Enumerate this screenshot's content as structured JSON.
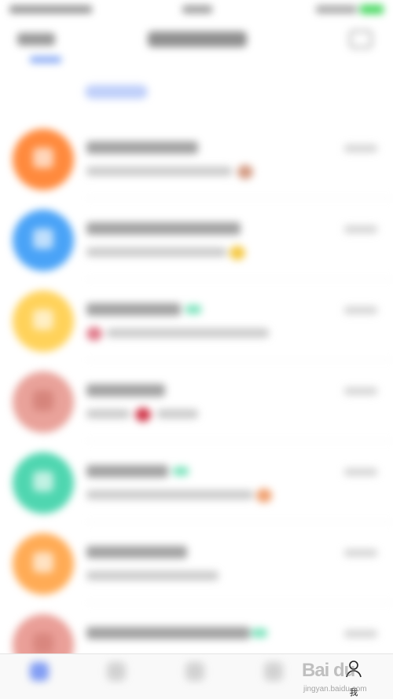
{
  "tab_bar": {
    "me_label": "我"
  },
  "watermark": {
    "logo": "Bai du",
    "url": "jingyan.baidu.com"
  },
  "chat_avatar_colors": [
    "#ff8a3d",
    "#4aa3f7",
    "#ffd25a",
    "#e9a29a",
    "#4fd6b0",
    "#ffab55",
    "#ea9f98"
  ],
  "accent_color": "#5b7ff2"
}
